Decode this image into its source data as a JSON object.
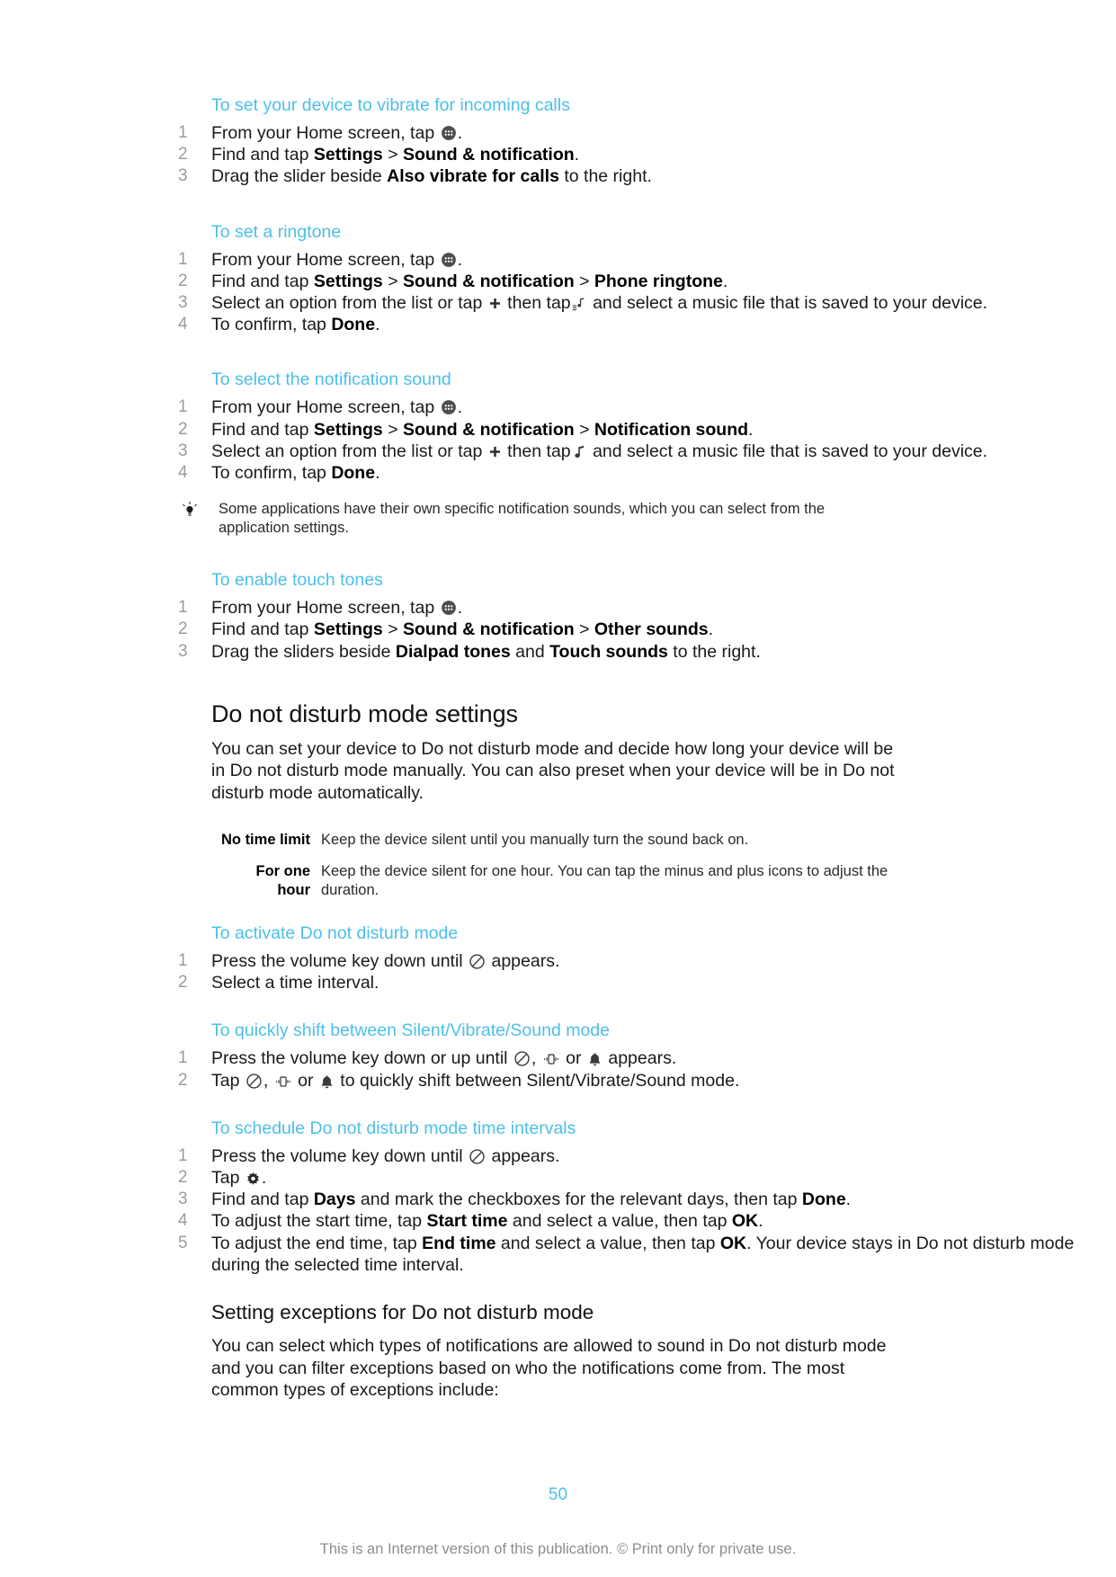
{
  "document": {
    "page_number": "50",
    "copyright": "This is an Internet version of this publication. © Print only for private use.",
    "accent_color": "#4cbfe9",
    "text_color": "#1a1a1a",
    "number_color": "#9b9b9b",
    "footer_color": "#8d8d8d"
  },
  "procedures": [
    {
      "id": "vibrate-incoming-calls",
      "title": "To set your device to vibrate for incoming calls",
      "steps": [
        {
          "num": "1",
          "parts": [
            {
              "t": "text",
              "v": "From your Home screen, tap "
            },
            {
              "t": "icon",
              "v": "apps-icon"
            },
            {
              "t": "text",
              "v": "."
            }
          ]
        },
        {
          "num": "2",
          "parts": [
            {
              "t": "text",
              "v": "Find and tap "
            },
            {
              "t": "bold",
              "v": "Settings"
            },
            {
              "t": "text",
              "v": " > "
            },
            {
              "t": "bold",
              "v": "Sound & notification"
            },
            {
              "t": "text",
              "v": "."
            }
          ]
        },
        {
          "num": "3",
          "parts": [
            {
              "t": "text",
              "v": "Drag the slider beside "
            },
            {
              "t": "bold",
              "v": "Also vibrate for calls"
            },
            {
              "t": "text",
              "v": " to the right."
            }
          ]
        }
      ]
    },
    {
      "id": "set-a-ringtone",
      "title": "To set a ringtone",
      "steps": [
        {
          "num": "1",
          "parts": [
            {
              "t": "text",
              "v": "From your Home screen, tap "
            },
            {
              "t": "icon",
              "v": "apps-icon"
            },
            {
              "t": "text",
              "v": "."
            }
          ]
        },
        {
          "num": "2",
          "parts": [
            {
              "t": "text",
              "v": "Find and tap "
            },
            {
              "t": "bold",
              "v": "Settings"
            },
            {
              "t": "text",
              "v": " > "
            },
            {
              "t": "bold",
              "v": "Sound & notification"
            },
            {
              "t": "text",
              "v": " > "
            },
            {
              "t": "bold",
              "v": "Phone ringtone"
            },
            {
              "t": "text",
              "v": "."
            }
          ]
        },
        {
          "num": "3",
          "parts": [
            {
              "t": "text",
              "v": "Select an option from the list or tap "
            },
            {
              "t": "icon",
              "v": "plus-icon"
            },
            {
              "t": "text",
              "v": " then tap"
            },
            {
              "t": "icon",
              "v": "music-list-icon"
            },
            {
              "t": "text",
              "v": " and select a music file that is saved to your device."
            }
          ]
        },
        {
          "num": "4",
          "parts": [
            {
              "t": "text",
              "v": "To confirm, tap "
            },
            {
              "t": "bold",
              "v": "Done"
            },
            {
              "t": "text",
              "v": "."
            }
          ]
        }
      ]
    },
    {
      "id": "select-notification-sound",
      "title": "To select the notification sound",
      "steps": [
        {
          "num": "1",
          "parts": [
            {
              "t": "text",
              "v": "From your Home screen, tap "
            },
            {
              "t": "icon",
              "v": "apps-icon"
            },
            {
              "t": "text",
              "v": "."
            }
          ]
        },
        {
          "num": "2",
          "parts": [
            {
              "t": "text",
              "v": "Find and tap "
            },
            {
              "t": "bold",
              "v": "Settings"
            },
            {
              "t": "text",
              "v": " > "
            },
            {
              "t": "bold",
              "v": "Sound & notification"
            },
            {
              "t": "text",
              "v": " > "
            },
            {
              "t": "bold",
              "v": "Notification sound"
            },
            {
              "t": "text",
              "v": "."
            }
          ]
        },
        {
          "num": "3",
          "parts": [
            {
              "t": "text",
              "v": "Select an option from the list or tap "
            },
            {
              "t": "icon",
              "v": "plus-icon"
            },
            {
              "t": "text",
              "v": " then tap"
            },
            {
              "t": "icon",
              "v": "music-note-icon"
            },
            {
              "t": "text",
              "v": " and select a music file that is saved to your device."
            }
          ]
        },
        {
          "num": "4",
          "parts": [
            {
              "t": "text",
              "v": "To confirm, tap "
            },
            {
              "t": "bold",
              "v": "Done"
            },
            {
              "t": "text",
              "v": "."
            }
          ]
        }
      ]
    }
  ],
  "tip": {
    "icon": "lightbulb-icon",
    "text": "Some applications have their own specific notification sounds, which you can select from the application settings."
  },
  "touch_tones": {
    "id": "enable-touch-tones",
    "title": "To enable touch tones",
    "steps": [
      {
        "num": "1",
        "parts": [
          {
            "t": "text",
            "v": "From your Home screen, tap "
          },
          {
            "t": "icon",
            "v": "apps-icon"
          },
          {
            "t": "text",
            "v": "."
          }
        ]
      },
      {
        "num": "2",
        "parts": [
          {
            "t": "text",
            "v": "Find and tap "
          },
          {
            "t": "bold",
            "v": "Settings"
          },
          {
            "t": "text",
            "v": " > "
          },
          {
            "t": "bold",
            "v": "Sound & notification"
          },
          {
            "t": "text",
            "v": " > "
          },
          {
            "t": "bold",
            "v": "Other sounds"
          },
          {
            "t": "text",
            "v": "."
          }
        ]
      },
      {
        "num": "3",
        "parts": [
          {
            "t": "text",
            "v": "Drag the sliders beside "
          },
          {
            "t": "bold",
            "v": "Dialpad tones"
          },
          {
            "t": "text",
            "v": " and "
          },
          {
            "t": "bold",
            "v": "Touch sounds"
          },
          {
            "t": "text",
            "v": " to the right."
          }
        ]
      }
    ]
  },
  "dnd_section": {
    "heading": "Do not disturb mode settings",
    "intro": "You can set your device to Do not disturb mode and decide how long your device will be in Do not disturb mode manually. You can also preset when your device will be in Do not disturb mode automatically.",
    "definitions": [
      {
        "term": "No time limit",
        "desc": "Keep the device silent until you manually turn the sound back on."
      },
      {
        "term": "For one hour",
        "desc": "Keep the device silent for one hour. You can tap the minus and plus icons to adjust the duration."
      }
    ]
  },
  "dnd_procedures": [
    {
      "id": "activate-dnd",
      "title": "To activate Do not disturb mode",
      "steps": [
        {
          "num": "1",
          "parts": [
            {
              "t": "text",
              "v": "Press the volume key down until "
            },
            {
              "t": "icon",
              "v": "do-not-disturb-icon"
            },
            {
              "t": "text",
              "v": " appears."
            }
          ]
        },
        {
          "num": "2",
          "parts": [
            {
              "t": "text",
              "v": "Select a time interval."
            }
          ]
        }
      ]
    },
    {
      "id": "quick-shift-modes",
      "title": "To quickly shift between Silent/Vibrate/Sound mode",
      "steps": [
        {
          "num": "1",
          "parts": [
            {
              "t": "text",
              "v": "Press the volume key down or up until "
            },
            {
              "t": "icon",
              "v": "do-not-disturb-icon"
            },
            {
              "t": "text",
              "v": ", "
            },
            {
              "t": "icon",
              "v": "vibrate-icon"
            },
            {
              "t": "text",
              "v": " or "
            },
            {
              "t": "icon",
              "v": "bell-icon"
            },
            {
              "t": "text",
              "v": " appears."
            }
          ]
        },
        {
          "num": "2",
          "parts": [
            {
              "t": "text",
              "v": "Tap "
            },
            {
              "t": "icon",
              "v": "do-not-disturb-icon"
            },
            {
              "t": "text",
              "v": ", "
            },
            {
              "t": "icon",
              "v": "vibrate-icon"
            },
            {
              "t": "text",
              "v": " or "
            },
            {
              "t": "icon",
              "v": "bell-icon"
            },
            {
              "t": "text",
              "v": " to quickly shift between Silent/Vibrate/Sound mode."
            }
          ]
        }
      ]
    },
    {
      "id": "schedule-dnd-intervals",
      "title": "To schedule Do not disturb mode time intervals",
      "steps": [
        {
          "num": "1",
          "parts": [
            {
              "t": "text",
              "v": "Press the volume key down until "
            },
            {
              "t": "icon",
              "v": "do-not-disturb-icon"
            },
            {
              "t": "text",
              "v": " appears."
            }
          ]
        },
        {
          "num": "2",
          "parts": [
            {
              "t": "text",
              "v": "Tap "
            },
            {
              "t": "icon",
              "v": "gear-icon"
            },
            {
              "t": "text",
              "v": "."
            }
          ]
        },
        {
          "num": "3",
          "parts": [
            {
              "t": "text",
              "v": "Find and tap "
            },
            {
              "t": "bold",
              "v": "Days"
            },
            {
              "t": "text",
              "v": " and mark the checkboxes for the relevant days, then tap "
            },
            {
              "t": "bold",
              "v": "Done"
            },
            {
              "t": "text",
              "v": "."
            }
          ]
        },
        {
          "num": "4",
          "parts": [
            {
              "t": "text",
              "v": "To adjust the start time, tap "
            },
            {
              "t": "bold",
              "v": "Start time"
            },
            {
              "t": "text",
              "v": " and select a value, then tap "
            },
            {
              "t": "bold",
              "v": "OK"
            },
            {
              "t": "text",
              "v": "."
            }
          ]
        },
        {
          "num": "5",
          "parts": [
            {
              "t": "text",
              "v": "To adjust the end time, tap "
            },
            {
              "t": "bold",
              "v": "End time"
            },
            {
              "t": "text",
              "v": " and select a value, then tap "
            },
            {
              "t": "bold",
              "v": "OK"
            },
            {
              "t": "text",
              "v": ". Your device stays in Do not disturb mode during the selected time interval."
            }
          ]
        }
      ]
    }
  ],
  "exceptions_section": {
    "heading": "Setting exceptions for Do not disturb mode",
    "body": "You can select which types of notifications are allowed to sound in Do not disturb mode and you can filter exceptions based on who the notifications come from. The most common types of exceptions include:"
  }
}
